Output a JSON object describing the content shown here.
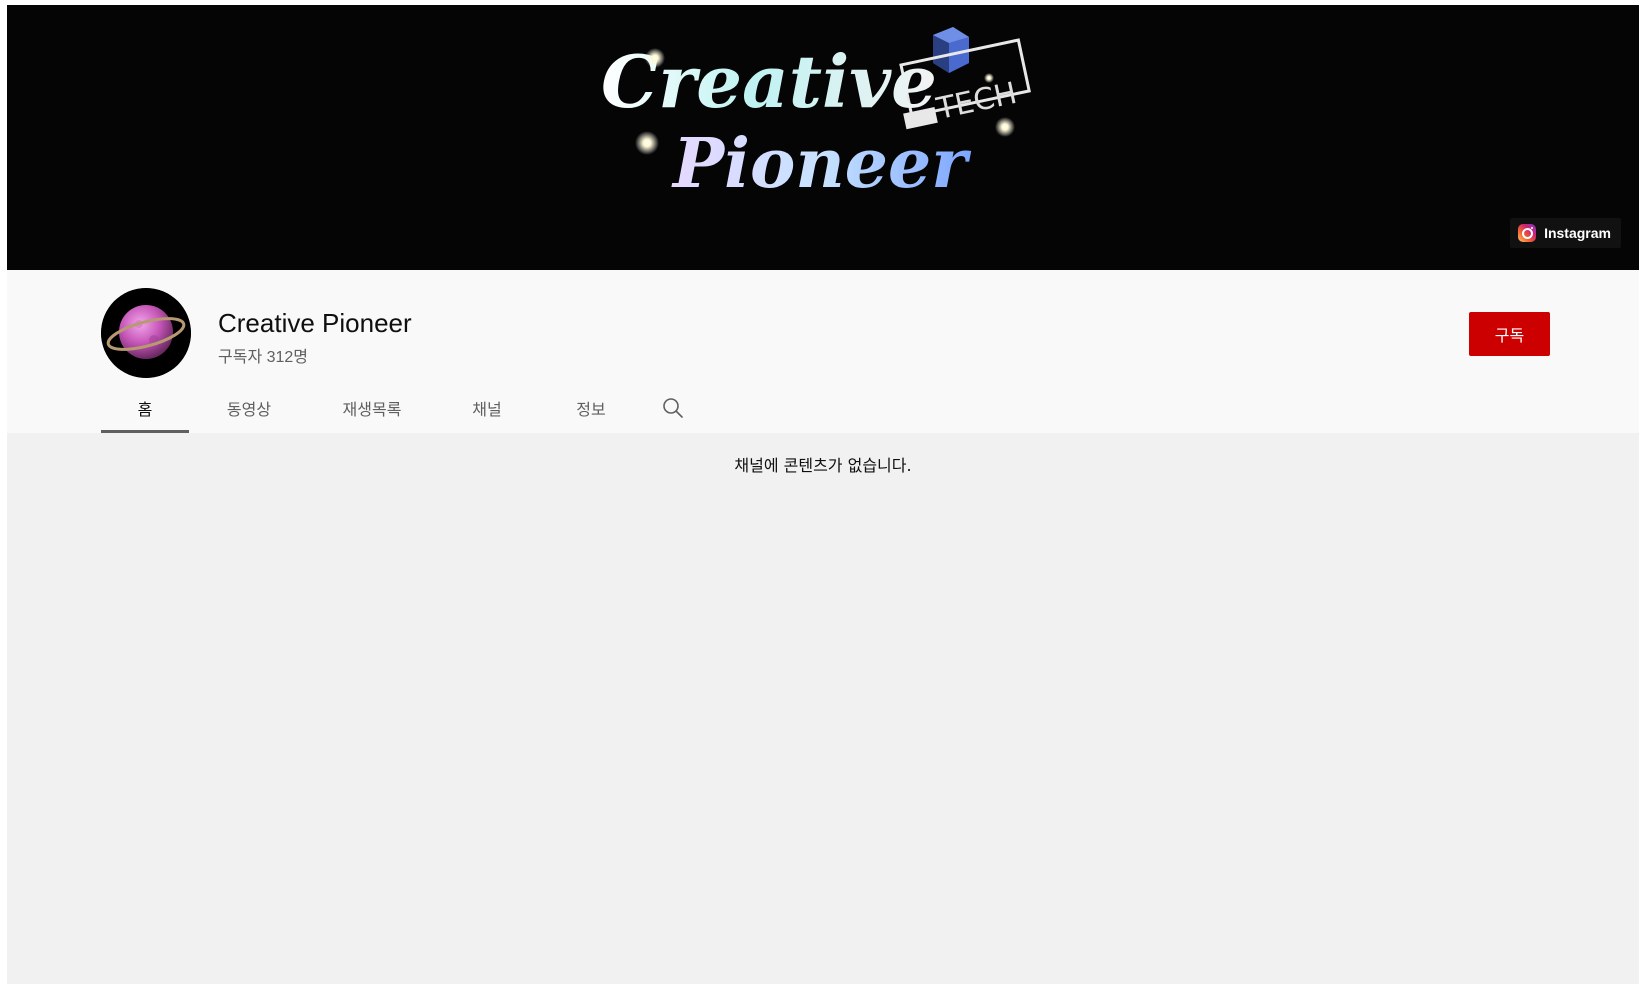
{
  "banner": {
    "logo_text_line1": "Creative",
    "logo_text_line2": "Pioneer",
    "logo_badge": "TECH",
    "link_label": "Instagram",
    "link_icon": "instagram-icon"
  },
  "channel": {
    "name": "Creative Pioneer",
    "subscribers": "구독자 312명",
    "subscribe_label": "구독",
    "avatar_icon": "planet-icon"
  },
  "tabs": [
    {
      "label": "홈",
      "active": true
    },
    {
      "label": "동영상",
      "active": false
    },
    {
      "label": "재생목록",
      "active": false
    },
    {
      "label": "채널",
      "active": false
    },
    {
      "label": "정보",
      "active": false
    }
  ],
  "search": {
    "icon": "search-icon"
  },
  "content": {
    "empty_message": "채널에 콘텐츠가 없습니다."
  },
  "colors": {
    "subscribe_button": "#cc0000",
    "banner_background": "#050505",
    "header_background": "#f9f9f9",
    "content_background": "#f1f1f1"
  }
}
